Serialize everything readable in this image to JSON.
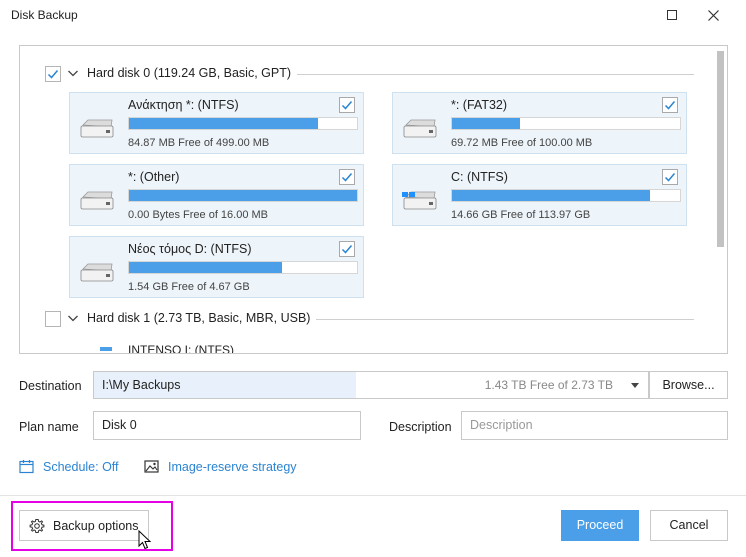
{
  "window": {
    "title": "Disk Backup"
  },
  "disks": [
    {
      "label": "Hard disk 0 (119.24 GB, Basic, GPT)",
      "checked": true,
      "partitions": [
        {
          "name": "Ανάκτηση *: (NTFS)",
          "free": "84.87 MB Free of 499.00 MB",
          "used_fraction": 0.83,
          "icon": "drive-icon",
          "checked": true
        },
        {
          "name": "*: (FAT32)",
          "free": "69.72 MB Free of 100.00 MB",
          "used_fraction": 0.3,
          "icon": "drive-icon",
          "checked": true
        },
        {
          "name": "*: (Other)",
          "free": "0.00 Bytes Free of 16.00 MB",
          "used_fraction": 1.0,
          "icon": "drive-icon",
          "checked": true
        },
        {
          "name": "C: (NTFS)",
          "free": "14.66 GB Free of 113.97 GB",
          "used_fraction": 0.87,
          "icon": "windows-drive-icon",
          "checked": true
        },
        {
          "name": "Νέος τόμος D: (NTFS)",
          "free": "1.54 GB Free of 4.67 GB",
          "used_fraction": 0.67,
          "icon": "drive-icon",
          "checked": true
        }
      ]
    },
    {
      "label": "Hard disk 1 (2.73 TB, Basic, MBR, USB)",
      "checked": false,
      "partitions": [
        {
          "name": "INTENSO I: (NTFS)"
        }
      ]
    }
  ],
  "destination": {
    "label": "Destination",
    "value": "I:\\My Backups",
    "free": "1.43 TB Free of 2.73 TB",
    "browse_label": "Browse..."
  },
  "plan": {
    "name_label": "Plan name",
    "name_value": "Disk 0",
    "description_label": "Description",
    "description_placeholder": "Description"
  },
  "links": {
    "schedule": "Schedule: Off",
    "image_reserve": "Image-reserve strategy"
  },
  "footer": {
    "backup_options": "Backup options",
    "proceed": "Proceed",
    "cancel": "Cancel"
  },
  "colors": {
    "accent": "#4b9fe8",
    "link": "#2b84d2",
    "highlight": "#e600e6",
    "partition_bg": "#edf4fa"
  }
}
